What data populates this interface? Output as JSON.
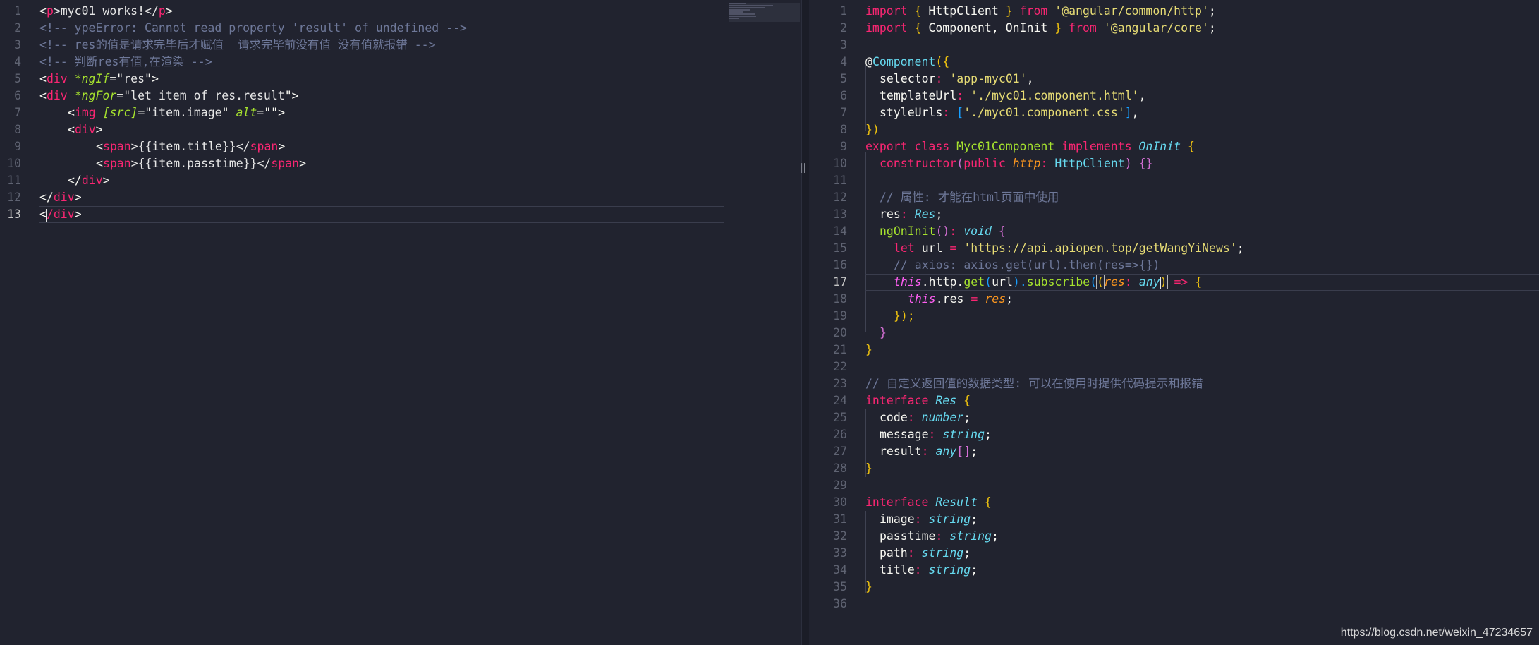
{
  "colors": {
    "background": "#21232f",
    "tag": "#f92672",
    "comment": "#6e7899",
    "string": "#e6db74",
    "function": "#a6e22e",
    "type": "#66d9ef",
    "param": "#fd971f"
  },
  "left_editor": {
    "file_label": "",
    "active_line": "13",
    "line_numbers": [
      "1",
      "2",
      "3",
      "4",
      "5",
      "6",
      "7",
      "8",
      "9",
      "10",
      "11",
      "12",
      "13"
    ]
  },
  "right_editor": {
    "active_line": "17",
    "line_numbers": [
      "1",
      "2",
      "3",
      "4",
      "5",
      "6",
      "7",
      "8",
      "9",
      "10",
      "11",
      "12",
      "13",
      "14",
      "15",
      "16",
      "17",
      "18",
      "19",
      "20",
      "21",
      "22",
      "23",
      "24",
      "25",
      "26",
      "27",
      "28",
      "29",
      "30",
      "31",
      "32",
      "33",
      "34",
      "35",
      "36"
    ]
  },
  "html_code": {
    "l1": {
      "a": "<",
      "b": "p",
      "c": ">myc01 works!</",
      "d": "p",
      "e": ">"
    },
    "l2": "<!-- ypeError: Cannot read property 'result' of undefined -->",
    "l3": "<!-- res的值是请求完毕后才赋值  请求完毕前没有值 没有值就报错 -->",
    "l4": "<!-- 判断res有值,在渲染 -->",
    "l5": {
      "a": "<",
      "b": "div",
      "c": " ",
      "d": "*ngIf",
      "e": "=\"",
      "f": "res",
      "g": "\">"
    },
    "l6": {
      "a": "<",
      "b": "div",
      "c": " ",
      "d": "*ngFor",
      "e": "=\"",
      "f": "let item of res.result",
      "g": "\">"
    },
    "l7": {
      "a": "<",
      "b": "img",
      "c": " ",
      "d": "[src]",
      "e": "=\"",
      "f": "item.image",
      "g": "\" ",
      "h": "alt",
      "i": "=\"\">"
    },
    "l8": {
      "a": "<",
      "b": "div",
      "c": ">"
    },
    "l9": {
      "a": "<",
      "b": "span",
      "c": ">{{item.title}}</",
      "d": "span",
      "e": ">"
    },
    "l10": {
      "a": "<",
      "b": "span",
      "c": ">{{item.passtime}}</",
      "d": "span",
      "e": ">"
    },
    "l11": {
      "a": "</",
      "b": "div",
      "c": ">"
    },
    "l12": {
      "a": "</",
      "b": "div",
      "c": ">"
    },
    "l13": {
      "a": "<",
      "b": "/div",
      "c": ">"
    }
  },
  "ts_code": {
    "l1": {
      "kw": "import",
      "o": " { ",
      "id": "HttpClient",
      "c": " } ",
      "from": "from",
      "s": " '@angular/common/http'",
      "e": ";"
    },
    "l2": {
      "kw": "import",
      "o": " { ",
      "id": "Component, OnInit",
      "c": " } ",
      "from": "from",
      "s": " '@angular/core'",
      "e": ";"
    },
    "l4": {
      "at": "@",
      "deco": "Component",
      "o": "({"
    },
    "l5": {
      "k": "selector",
      "c": ": ",
      "v": "'app-myc01'",
      "e": ","
    },
    "l6": {
      "k": "templateUrl",
      "c": ": ",
      "v": "'./myc01.component.html'",
      "e": ","
    },
    "l7": {
      "k": "styleUrls",
      "c": ": ",
      "o": "[",
      "v": "'./myc01.component.css'",
      "cl": "]",
      "e": ","
    },
    "l8": {
      "v": "})"
    },
    "l9": {
      "kw": "export",
      "s1": " ",
      "kw2": "class",
      "s2": " ",
      "cls": "Myc01Component",
      "s3": " ",
      "kw3": "implements",
      "s4": " ",
      "iface": "OnInit",
      "o": " {"
    },
    "l10": {
      "fn": "constructor",
      "o": "(",
      "kw": "public",
      "s": " ",
      "p": "http",
      "c": ": ",
      "t": "HttpClient",
      "cl": ")",
      "b": " {}"
    },
    "l12": "// 属性: 才能在html页面中使用",
    "l13": {
      "k": "res",
      "c": ": ",
      "t": "Res",
      "e": ";"
    },
    "l14": {
      "fn": "ngOnInit",
      "o": "()",
      "c": ": ",
      "t": "void",
      "b": " {"
    },
    "l15": {
      "kw": "let",
      "s": " url ",
      "op": "=",
      "s2": " ",
      "q": "'",
      "url": "https://api.apiopen.top/getWangYiNews",
      "q2": "'",
      "e": ";"
    },
    "l16": "// axios: axios.get(url).then(res=>{})",
    "l17": {
      "th": "this",
      "a": ".http.",
      "fn": "get",
      "o": "(",
      "u": "url",
      "c": ").",
      "fn2": "subscribe",
      "o2": "(",
      "b": "(",
      "p": "res",
      "cn": ": ",
      "t": "any",
      "b2": ")",
      "ar": " => ",
      "br": "{"
    },
    "l18": {
      "th": "this",
      "a": ".res ",
      "op": "=",
      "s": " ",
      "p": "res",
      "e": ";"
    },
    "l19": {
      "a": "});"
    },
    "l20": {
      "a": "}"
    },
    "l21": {
      "a": "}"
    },
    "l23": "// 自定义返回值的数据类型: 可以在使用时提供代码提示和报错",
    "l24": {
      "kw": "interface",
      "s": " ",
      "t": "Res",
      "o": " {"
    },
    "l25": {
      "k": "code",
      "c": ": ",
      "t": "number",
      "e": ";"
    },
    "l26": {
      "k": "message",
      "c": ": ",
      "t": "string",
      "e": ";"
    },
    "l27": {
      "k": "result",
      "c": ": ",
      "t": "any",
      "a": "[]",
      "e": ";"
    },
    "l28": {
      "a": "}"
    },
    "l30": {
      "kw": "interface",
      "s": " ",
      "t": "Result",
      "o": " {"
    },
    "l31": {
      "k": "image",
      "c": ": ",
      "t": "string",
      "e": ";"
    },
    "l32": {
      "k": "passtime",
      "c": ": ",
      "t": "string",
      "e": ";"
    },
    "l33": {
      "k": "path",
      "c": ": ",
      "t": "string",
      "e": ";"
    },
    "l34": {
      "k": "title",
      "c": ": ",
      "t": "string",
      "e": ";"
    },
    "l35": {
      "a": "}"
    }
  },
  "watermark": "https://blog.csdn.net/weixin_47234657"
}
